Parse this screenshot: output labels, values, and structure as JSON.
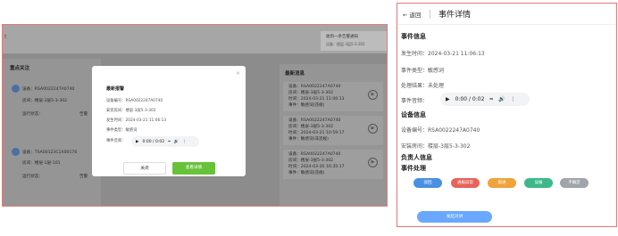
{
  "dashboard": {
    "edge_char": "t",
    "notice": {
      "title": "收到一条告警通知",
      "subtitle": "设备：楼层-3层5-3-302"
    },
    "left_panel": {
      "title": "重点关注",
      "devices": [
        {
          "device": "设备：RSA0022247A0740",
          "location": "房间：楼层-3层5-3-302",
          "status_label": "运行状态：",
          "status_value": "告警"
        },
        {
          "device": "设备：TSA00123C1X00176",
          "location": "房间：楼层-1层-101",
          "status_label": "运行状态：",
          "status_value": "告警"
        }
      ]
    },
    "right_panel": {
      "title": "最新消息",
      "messages": [
        {
          "line1": "设备：RSA0022247A0740",
          "line2": "房间：楼层-3层5-3-302",
          "line3": "时间：2024-03-21 11:06:13",
          "line4": "事件：敏感词(违规)"
        },
        {
          "line1": "设备：RSA0022247A0740",
          "line2": "房间：楼层-3层5-3-302",
          "line3": "时间：2024-03-21 10:59:17",
          "line4": "事件：敏感词(非违规)"
        },
        {
          "line1": "设备：RSA0022247A0740",
          "line2": "房间：楼层-3层5-3-302",
          "line3": "时间：2024-03-20 16:35:17",
          "line4": "事件：敏感词(违规)"
        }
      ]
    },
    "modal": {
      "title": "最新报警",
      "close": "×",
      "rows": [
        {
          "label": "设备编号：",
          "value": "RSA0022247A0740"
        },
        {
          "label": "安装房间：",
          "value": "楼层-3层5-3-302"
        },
        {
          "label": "发生时间：",
          "value": "2024-03-21 11:06:13"
        },
        {
          "label": "事件类型：",
          "value": "敏感词"
        },
        {
          "label": "事件音频：",
          "value": ""
        }
      ],
      "audio_time": "0:00 / 0:02",
      "close_button": "关闭",
      "view_button": "查看详情"
    }
  },
  "detail": {
    "back_label": "← 返回",
    "title": "事件详情",
    "event_section": "事件信息",
    "occurred_label": "发生时间：",
    "occurred_value": "2024-03-21 11:06:13",
    "type_label": "事件类型：",
    "type_value": "敏感词",
    "result_label": "处理结果：",
    "result_value": "未处理",
    "audio_label": "事件音频：",
    "audio_time": "0:00 / 0:02",
    "device_section": "设备信息",
    "device_label": "设备编号：",
    "device_value": "RSA0022247A0740",
    "room_label": "安装房间：",
    "room_value": "楼层-3层5-3-302",
    "owner_section": "负责人信息",
    "handle_section": "事件处理",
    "actions": [
      {
        "label": "驳回",
        "color": "#4a90e2"
      },
      {
        "label": "通报异常",
        "color": "#e8635a"
      },
      {
        "label": "跟进",
        "color": "#f0a33a"
      },
      {
        "label": "误报",
        "color": "#3db88b"
      },
      {
        "label": "不确定",
        "color": "#a0a4ab"
      }
    ],
    "confirm_button": "发起对讲"
  }
}
